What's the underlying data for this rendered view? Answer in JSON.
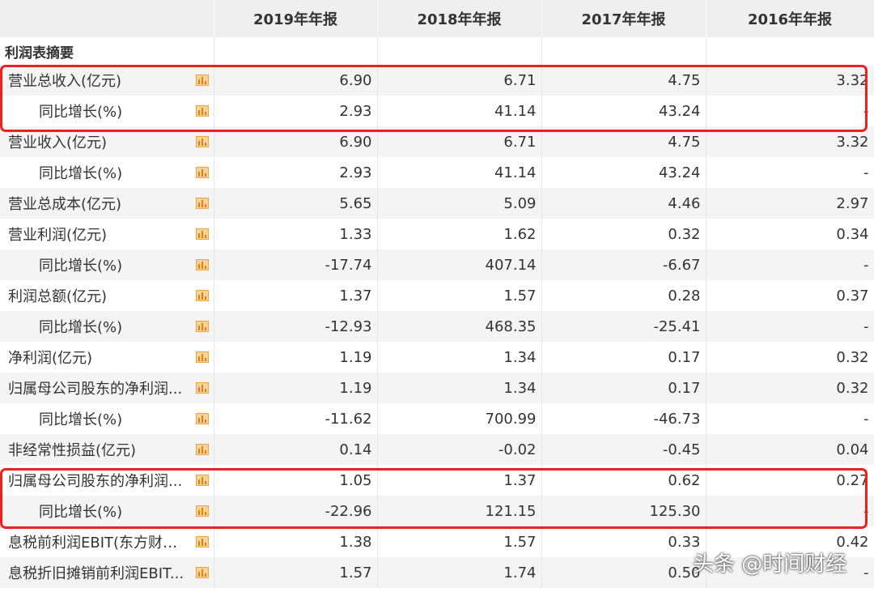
{
  "headers": [
    "",
    "2019年年报",
    "2018年年报",
    "2017年年报",
    "2016年年报"
  ],
  "section_title": "利润表摘要",
  "rows": [
    {
      "label": "营业总收入(亿元)",
      "sub": false,
      "values": [
        "6.90",
        "6.71",
        "4.75",
        "3.32"
      ]
    },
    {
      "label": "同比增长(%)",
      "sub": true,
      "values": [
        "2.93",
        "41.14",
        "43.24",
        "-"
      ]
    },
    {
      "label": "营业收入(亿元)",
      "sub": false,
      "values": [
        "6.90",
        "6.71",
        "4.75",
        "3.32"
      ]
    },
    {
      "label": "同比增长(%)",
      "sub": true,
      "values": [
        "2.93",
        "41.14",
        "43.24",
        "-"
      ]
    },
    {
      "label": "营业总成本(亿元)",
      "sub": false,
      "values": [
        "5.65",
        "5.09",
        "4.46",
        "2.97"
      ]
    },
    {
      "label": "营业利润(亿元)",
      "sub": false,
      "values": [
        "1.33",
        "1.62",
        "0.32",
        "0.34"
      ]
    },
    {
      "label": "同比增长(%)",
      "sub": true,
      "values": [
        "-17.74",
        "407.14",
        "-6.67",
        "-"
      ]
    },
    {
      "label": "利润总额(亿元)",
      "sub": false,
      "values": [
        "1.37",
        "1.57",
        "0.28",
        "0.37"
      ]
    },
    {
      "label": "同比增长(%)",
      "sub": true,
      "values": [
        "-12.93",
        "468.35",
        "-25.41",
        "-"
      ]
    },
    {
      "label": "净利润(亿元)",
      "sub": false,
      "values": [
        "1.19",
        "1.34",
        "0.17",
        "0.32"
      ]
    },
    {
      "label": "归属母公司股东的净利润...",
      "sub": false,
      "values": [
        "1.19",
        "1.34",
        "0.17",
        "0.32"
      ]
    },
    {
      "label": "同比增长(%)",
      "sub": true,
      "values": [
        "-11.62",
        "700.99",
        "-46.73",
        "-"
      ]
    },
    {
      "label": "非经常性损益(亿元)",
      "sub": false,
      "values": [
        "0.14",
        "-0.02",
        "-0.45",
        "0.04"
      ]
    },
    {
      "label": "归属母公司股东的净利润...",
      "sub": false,
      "values": [
        "1.05",
        "1.37",
        "0.62",
        "0.27"
      ]
    },
    {
      "label": "同比增长(%)",
      "sub": true,
      "values": [
        "-22.96",
        "121.15",
        "125.30",
        "-"
      ]
    },
    {
      "label": "息税前利润EBIT(东方财富...",
      "sub": false,
      "values": [
        "1.38",
        "1.57",
        "0.33",
        "0.42"
      ]
    },
    {
      "label": "息税折旧摊销前利润EBIT...",
      "sub": false,
      "values": [
        "1.57",
        "1.74",
        "0.50",
        "-"
      ]
    }
  ],
  "watermark": "头条 @时间财经",
  "colors": {
    "highlight": "#e8231f",
    "icon": "#f0a43b",
    "header_bg": "#efefef",
    "zebra": "#f4f4f4"
  },
  "icon_name": "bar-chart-icon"
}
